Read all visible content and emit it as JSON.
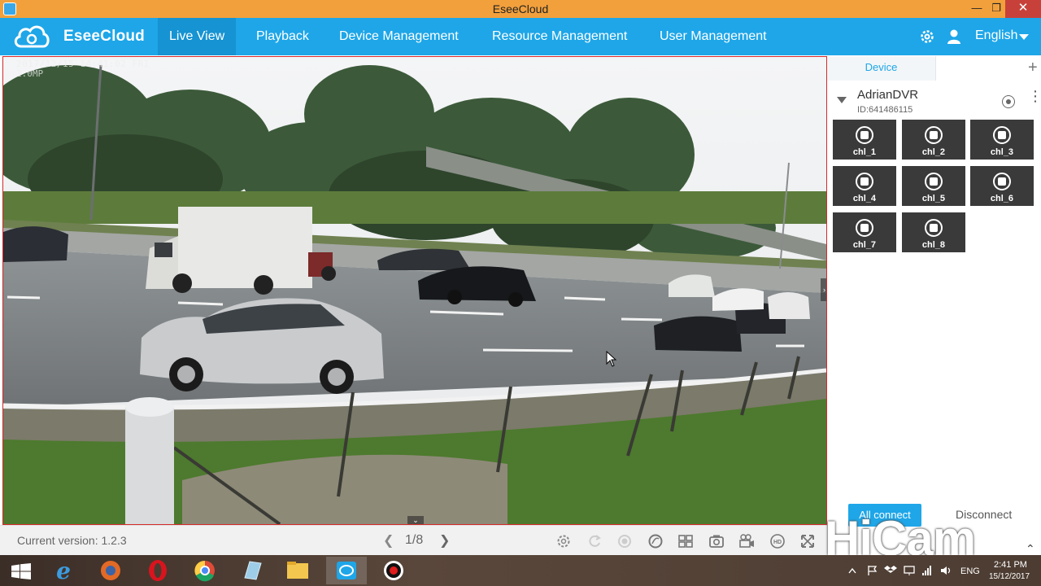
{
  "window": {
    "title": "EseeCloud"
  },
  "nav": {
    "brand": "EseeCloud",
    "items": [
      {
        "label": "Live View",
        "active": true
      },
      {
        "label": "Playback",
        "active": false
      },
      {
        "label": "Device Management",
        "active": false
      },
      {
        "label": "Resource Management",
        "active": false
      },
      {
        "label": "User Management",
        "active": false
      }
    ],
    "icons": [
      "gear-icon",
      "user-icon"
    ],
    "language": "English"
  },
  "video": {
    "osd_time": "2017/12/15 14:41:02 FRI",
    "osd_sub": "2.0MP"
  },
  "panel": {
    "tab": "Device",
    "device": {
      "name": "AdrianDVR",
      "id": "ID:641486115"
    },
    "channels": [
      "chl_1",
      "chl_2",
      "chl_3",
      "chl_4",
      "chl_5",
      "chl_6",
      "chl_7",
      "chl_8"
    ],
    "all_connect": "All connect",
    "disconnect": "Disconnect"
  },
  "bottom": {
    "version": "Current version: 1.2.3",
    "page": "1/8",
    "tools": [
      "settings-icon",
      "refresh-icon",
      "record-icon",
      "fullscreen-circle-icon",
      "split-screen-icon",
      "snapshot-icon",
      "video-record-icon",
      "hd-icon",
      "expand-icon"
    ]
  },
  "watermark": "HiCam",
  "taskbar": {
    "lang": "ENG",
    "time": "2:41 PM",
    "date": "15/12/2017",
    "accent": "#1ea6e8"
  }
}
